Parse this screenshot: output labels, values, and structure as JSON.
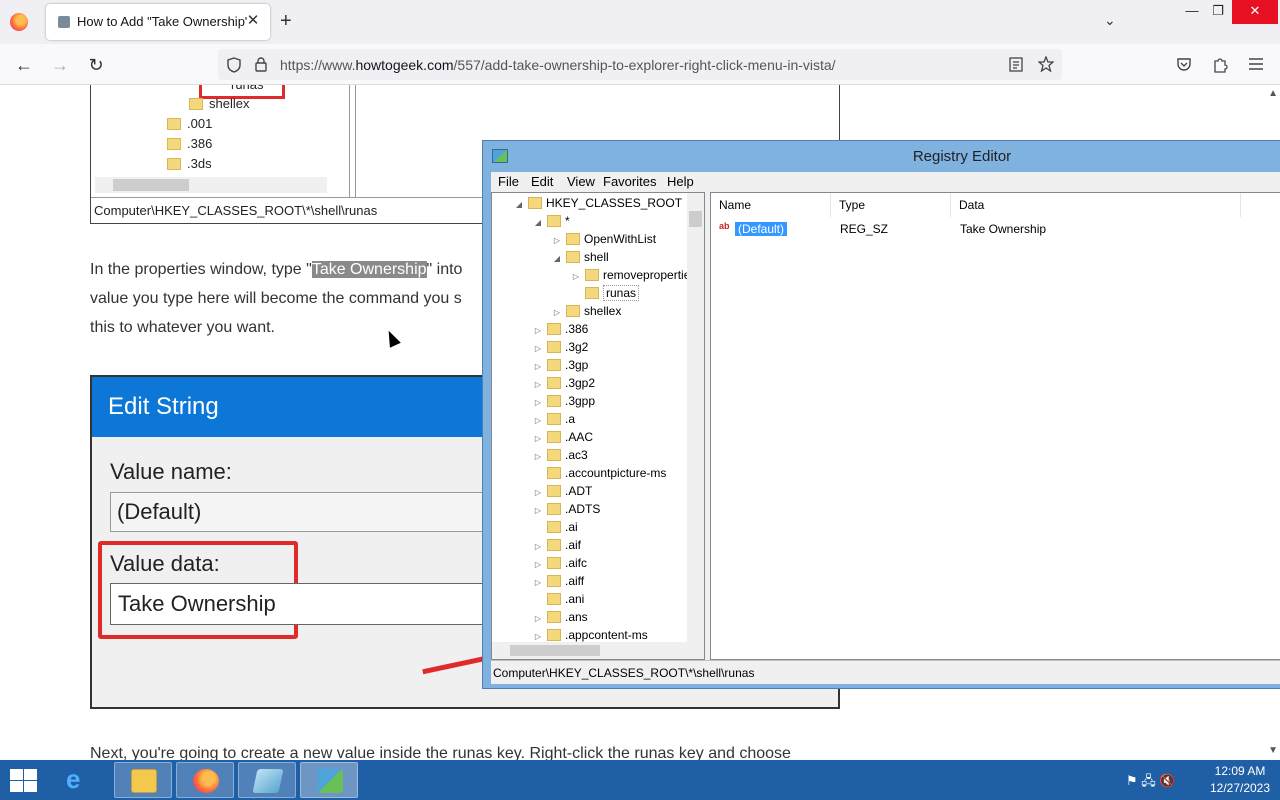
{
  "browser": {
    "tab_title": "How to Add \"Take Ownership\"",
    "tab_close": "✕",
    "new_tab": "+",
    "list_tabs": "⌄",
    "minimize": "—",
    "maximize": "❐",
    "close": "✕",
    "url_prefix": "https://www.",
    "url_host": "howtogeek.com",
    "url_path": "/557/add-take-ownership-to-explorer-right-click-menu-in-vista/",
    "back": "←",
    "forward": "→",
    "reload": "↻"
  },
  "article": {
    "shot1": {
      "items": [
        "runas",
        "shellex",
        ".001",
        ".386",
        ".3ds"
      ],
      "status": "Computer\\HKEY_CLASSES_ROOT\\*\\shell\\runas"
    },
    "para1_before": "In the properties window, type \"",
    "para1_highlight": "Take Ownership",
    "para1_after": "\" into",
    "para1_line2": "value you type here will become the command you s",
    "para1_line3": "this to whatever you want.",
    "edit_string": {
      "title": "Edit String",
      "value_name_label": "Value name:",
      "value_name": "(Default)",
      "value_data_label": "Value data:",
      "value_data": "Take Ownership"
    },
    "para2": "Next, you're going to create a new value inside the runas key. Right-click the runas key and choose"
  },
  "regedit": {
    "title": "Registry Editor",
    "menu": [
      "File",
      "Edit",
      "View",
      "Favorites",
      "Help"
    ],
    "tree": [
      {
        "label": "HKEY_CLASSES_ROOT",
        "exp": "◢"
      },
      {
        "label": "*",
        "exp": "◢"
      },
      {
        "label": "OpenWithList",
        "exp": "▷"
      },
      {
        "label": "shell",
        "exp": "◢"
      },
      {
        "label": "removepropertie",
        "exp": "▷"
      },
      {
        "label": "runas",
        "exp": ""
      },
      {
        "label": "shellex",
        "exp": "▷"
      },
      {
        "label": ".386",
        "exp": "▷"
      },
      {
        "label": ".3g2",
        "exp": "▷"
      },
      {
        "label": ".3gp",
        "exp": "▷"
      },
      {
        "label": ".3gp2",
        "exp": "▷"
      },
      {
        "label": ".3gpp",
        "exp": "▷"
      },
      {
        "label": ".a",
        "exp": "▷"
      },
      {
        "label": ".AAC",
        "exp": "▷"
      },
      {
        "label": ".ac3",
        "exp": "▷"
      },
      {
        "label": ".accountpicture-ms",
        "exp": ""
      },
      {
        "label": ".ADT",
        "exp": "▷"
      },
      {
        "label": ".ADTS",
        "exp": "▷"
      },
      {
        "label": ".ai",
        "exp": ""
      },
      {
        "label": ".aif",
        "exp": "▷"
      },
      {
        "label": ".aifc",
        "exp": "▷"
      },
      {
        "label": ".aiff",
        "exp": "▷"
      },
      {
        "label": ".ani",
        "exp": ""
      },
      {
        "label": ".ans",
        "exp": "▷"
      },
      {
        "label": ".appcontent-ms",
        "exp": "▷"
      }
    ],
    "columns": [
      "Name",
      "Type",
      "Data"
    ],
    "values": [
      {
        "name": "(Default)",
        "type": "REG_SZ",
        "data": "Take Ownership"
      }
    ],
    "status": "Computer\\HKEY_CLASSES_ROOT\\*\\shell\\runas"
  },
  "taskbar": {
    "time": "12:09 AM",
    "date": "12/27/2023",
    "tray": "⚑ 🖧 🔇"
  }
}
